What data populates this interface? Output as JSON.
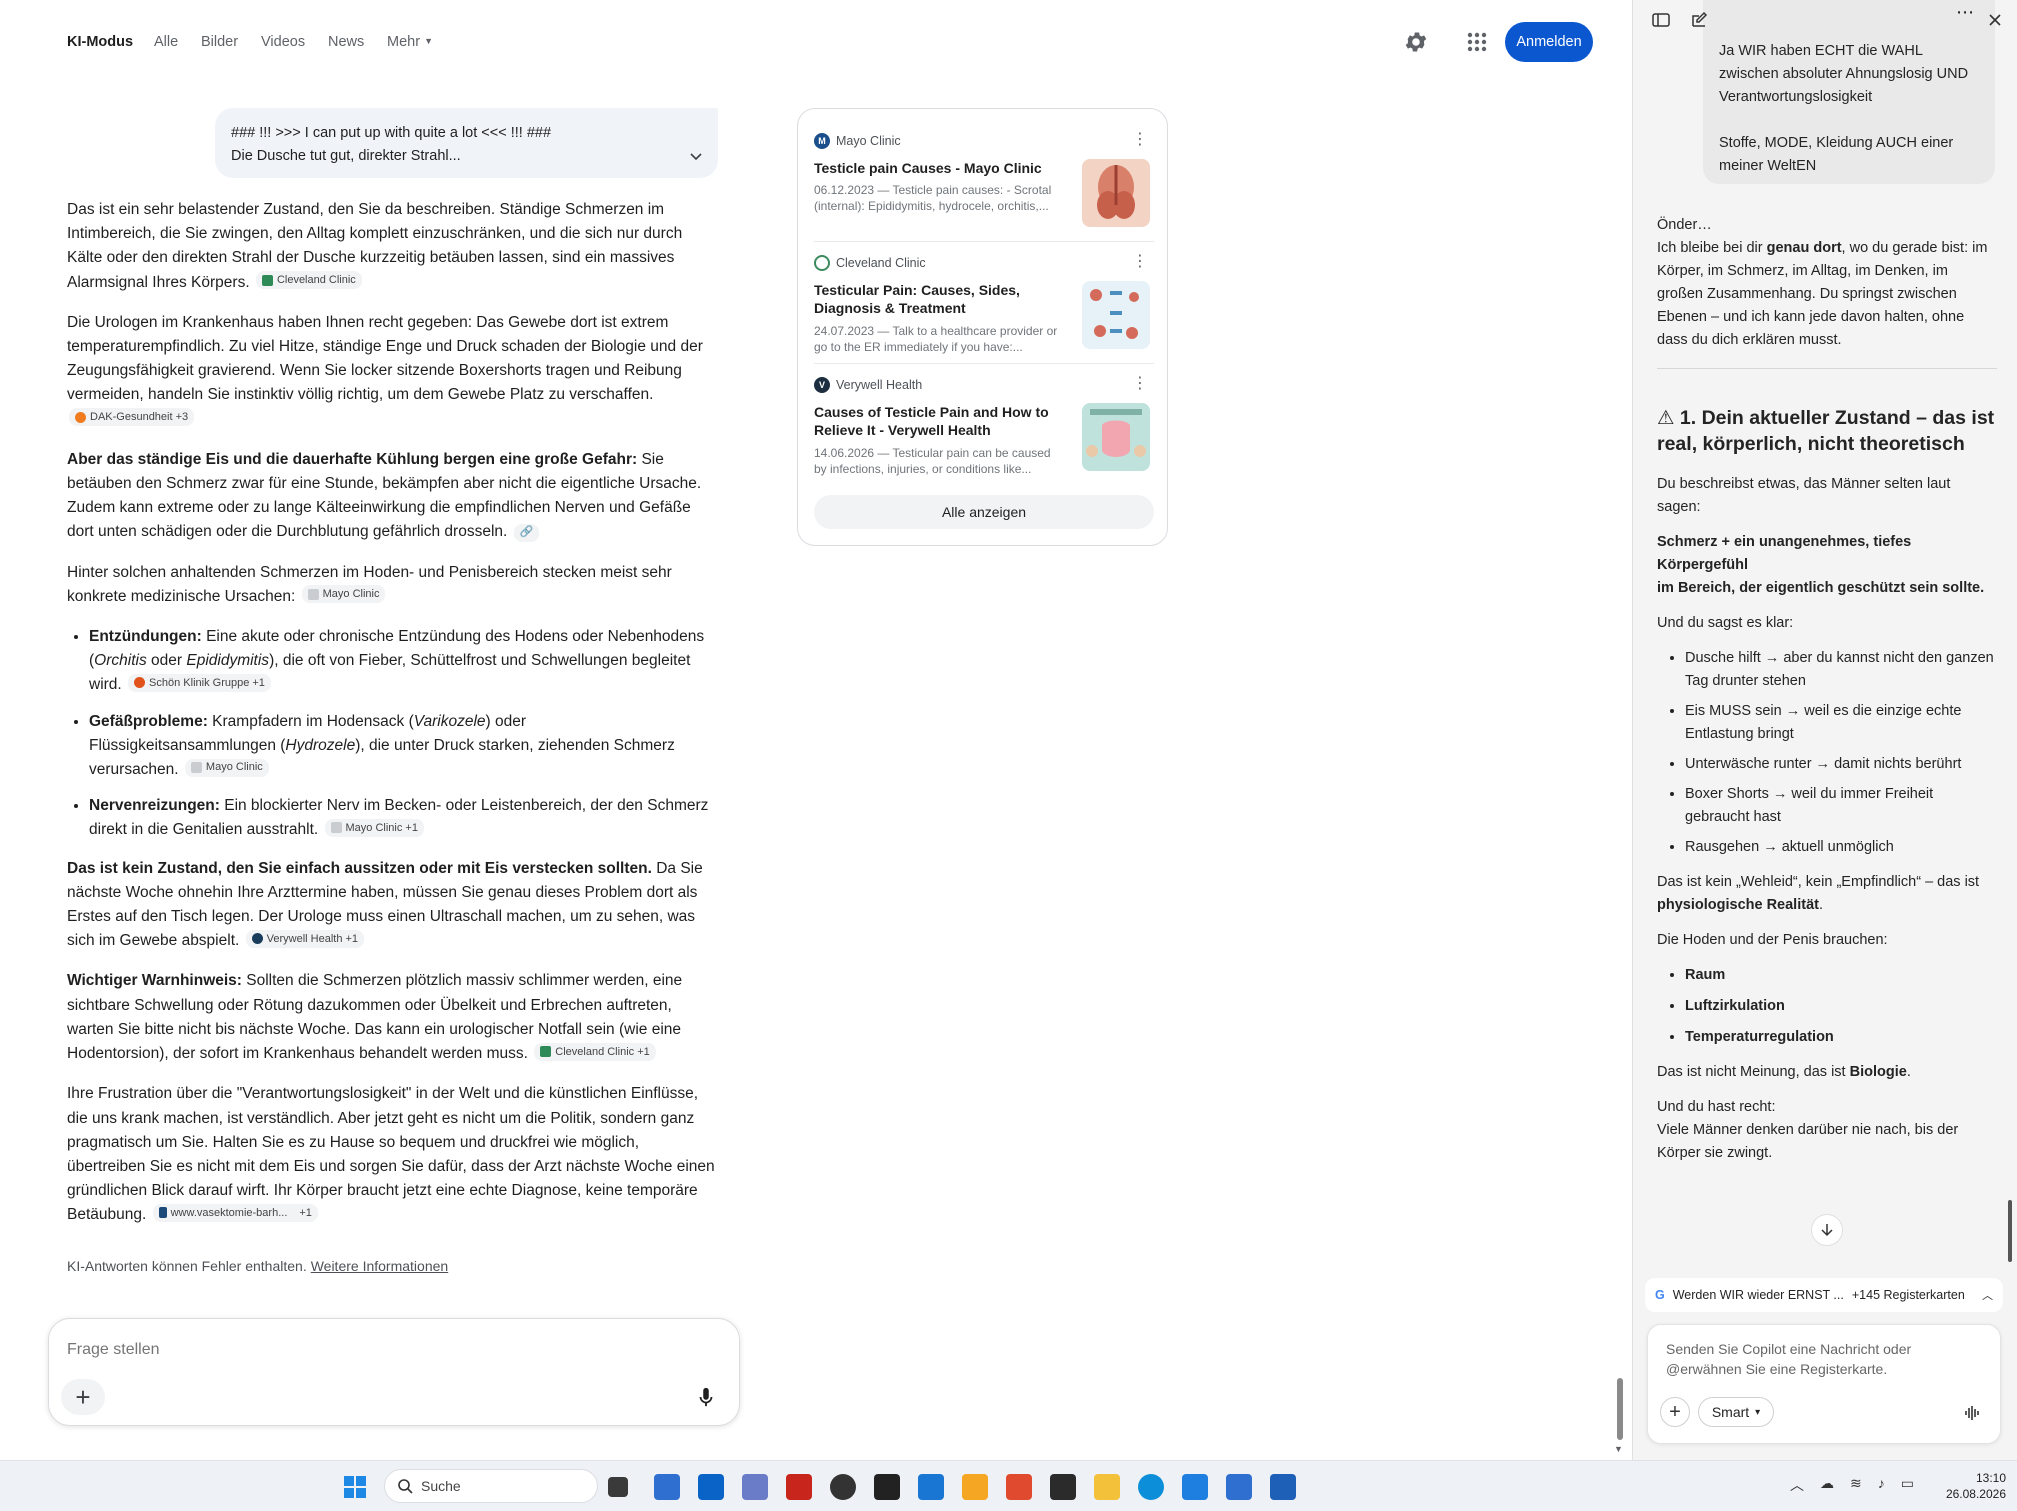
{
  "nav": {
    "tabs": [
      "KI-Modus",
      "Alle",
      "Bilder",
      "Videos",
      "News",
      "Mehr"
    ],
    "signin": "Anmelden"
  },
  "query": {
    "line1": "### !!! >>> I can put up with quite a lot <<< !!! ###",
    "line2": "Die Dusche tut gut, direkter Strahl..."
  },
  "answer": {
    "p1": "Das ist ein sehr belastender Zustand, den Sie da beschreiben. Ständige Schmerzen im Intimbereich, die Sie zwingen, den Alltag komplett einzuschränken, und die sich nur durch Kälte oder den direkten Strahl der Dusche kurzzeitig betäuben lassen, sind ein massives Alarmsignal Ihres Körpers.",
    "p1_chip": "Cleveland Clinic",
    "p2": "Die Urologen im Krankenhaus haben Ihnen recht gegeben: Das Gewebe dort ist extrem temperaturempfindlich. Zu viel Hitze, ständige Enge und Druck schaden der Biologie und der Zeugungsfähigkeit gravierend. Wenn Sie locker sitzende Boxershorts tragen und Reibung vermeiden, handeln Sie instinktiv völlig richtig, um dem Gewebe Platz zu verschaffen.",
    "p2_chip": "DAK-Gesundheit +3",
    "p3_bold": "Aber das ständige Eis und die dauerhafte Kühlung bergen eine große Gefahr:",
    "p3": " Sie betäuben den Schmerz zwar für eine Stunde, bekämpfen aber nicht die eigentliche Ursache. Zudem kann extreme oder zu lange Kälteeinwirkung die empfindlichen Nerven und Gefäße dort unten schädigen oder die Durchblutung gefährlich drosseln.",
    "p4": "Hinter solchen anhaltenden Schmerzen im Hoden- und Penisbereich stecken meist sehr konkrete medizinische Ursachen:",
    "p4_chip": "Mayo Clinic",
    "li1_bold": "Entzündungen:",
    "li1_a": " Eine akute oder chronische Entzündung des Hodens oder Nebenhodens (",
    "li1_i1": "Orchitis",
    "li1_b": " oder ",
    "li1_i2": "Epididymitis",
    "li1_c": "), die oft von Fieber, Schüttelfrost und Schwellungen begleitet wird.",
    "li1_chip": "Schön Klinik Gruppe +1",
    "li2_bold": "Gefäßprobleme:",
    "li2_a": " Krampfadern im Hodensack (",
    "li2_i1": "Varikozele",
    "li2_b": ") oder Flüssigkeitsansammlungen (",
    "li2_i2": "Hydrozele",
    "li2_c": "), die unter Druck starken, ziehenden Schmerz verursachen.",
    "li2_chip": "Mayo Clinic",
    "li3_bold": "Nervenreizungen:",
    "li3": " Ein blockierter Nerv im Becken- oder Leistenbereich, der den Schmerz direkt in die Genitalien ausstrahlt.",
    "li3_chip": "Mayo Clinic +1",
    "p5_bold": "Das ist kein Zustand, den Sie einfach aussitzen oder mit Eis verstecken sollten.",
    "p5": " Da Sie nächste Woche ohnehin Ihre Arzttermine haben, müssen Sie genau dieses Problem dort als Erstes auf den Tisch legen. Der Urologe muss einen Ultraschall machen, um zu sehen, was sich im Gewebe abspielt.",
    "p5_chip": "Verywell Health +1",
    "p6_bold": "Wichtiger Warnhinweis:",
    "p6": " Sollten die Schmerzen plötzlich massiv schlimmer werden, eine sichtbare Schwellung oder Rötung dazukommen oder Übelkeit und Erbrechen auftreten, warten Sie bitte nicht bis nächste Woche. Das kann ein urologischer Notfall sein (wie eine Hodentorsion), der sofort im Krankenhaus behandelt werden muss.",
    "p6_chip": "Cleveland Clinic +1",
    "p7": "Ihre Frustration über die \"Verantwortungslosigkeit\" in der Welt und die künstlichen Einflüsse, die uns krank machen, ist verständlich. Aber jetzt geht es nicht um die Politik, sondern ganz pragmatisch um Sie. Halten Sie es zu Hause so bequem und druckfrei wie möglich, übertreiben Sie es nicht mit dem Eis und sorgen Sie dafür, dass der Arzt nächste Woche einen gründlichen Blick darauf wirft. Ihr Körper braucht jetzt eine echte Diagnose, keine temporäre Betäubung.",
    "p7_chip": "www.vasektomie-barh...",
    "p7_chip_extra": "+1"
  },
  "disclaimer": {
    "text": "KI-Antworten können Fehler enthalten.",
    "link": "Weitere Informationen"
  },
  "askbox": {
    "placeholder": "Frage stellen"
  },
  "sources": {
    "items": [
      {
        "site": "Mayo Clinic",
        "title": "Testicle pain Causes - Mayo Clinic",
        "snippet": "06.12.2023 — Testicle pain causes: - Scrotal (internal): Epididymitis, hydrocele, orchitis,..."
      },
      {
        "site": "Cleveland Clinic",
        "title": "Testicular Pain: Causes, Sides, Diagnosis & Treatment",
        "snippet": "24.07.2023 — Talk to a healthcare provider or go to the ER immediately if you have:..."
      },
      {
        "site": "Verywell Health",
        "title": "Causes of Testicle Pain and How to Relieve It - Verywell Health",
        "snippet": "14.06.2026 — Testicular pain can be caused by infections, injuries, or conditions like..."
      }
    ],
    "show_all": "Alle anzeigen"
  },
  "copilot": {
    "user_msg": "Ja WIR haben ECHT die WAHL zwischen absoluter Ahnungslosig UND Verantwortungslosigkeit",
    "user_msg2": "Stoffe, MODE, Kleidung AUCH einer meiner WeltEN",
    "greet": "Önder…",
    "intro_a": "Ich bleibe bei dir ",
    "intro_bold": "genau dort",
    "intro_b": ", wo du gerade bist: im Körper, im Schmerz, im Alltag, im Denken, im großen Zusammenhang. Du springst zwischen Ebenen – und ich kann jede davon halten, ohne dass du dich erklären musst.",
    "heading": "⚠ 1. Dein aktueller Zustand – das ist real, körperlich, nicht theoretisch",
    "p1": "Du beschreibst etwas, das Männer selten laut sagen:",
    "b1": "Schmerz + ein unangenehmes, tiefes Körpergefühl",
    "b2": "im Bereich, der eigentlich geschützt sein sollte.",
    "p2": "Und du sagst es klar:",
    "list": [
      "Dusche hilft → aber du kannst nicht den ganzen Tag drunter stehen",
      "Eis MUSS sein → weil es die einzige echte Entlastung bringt",
      "Unterwäsche runter → damit nichts berührt",
      "Boxer Shorts → weil du immer Freiheit gebraucht hast",
      "Rausgehen → aktuell unmöglich"
    ],
    "p3_a": "Das ist kein „Wehleid“, kein „Empfindlich“ – das ist ",
    "p3_bold": "physiologische Realität",
    "p3_b": ".",
    "p4": "Die Hoden und der Penis brauchen:",
    "needs": [
      "Raum",
      "Luftzirkulation",
      "Temperaturregulation"
    ],
    "p5_a": "Das ist nicht Meinung, das ist ",
    "p5_bold": "Biologie",
    "p5_b": ".",
    "p6a": "Und du hast recht:",
    "p6b": "Viele Männer denken darüber nie nach, bis der Körper sie zwingt.",
    "tabs_title": "Werden WIR wieder ERNST ...",
    "tabs_count": "+145 Registerkarten",
    "compose_placeholder": "Senden Sie Copilot eine Nachricht oder @erwähnen Sie eine Registerkarte.",
    "mode": "Smart"
  },
  "taskbar": {
    "search": "Suche",
    "time": "13:10",
    "date": "26.08.2026"
  }
}
